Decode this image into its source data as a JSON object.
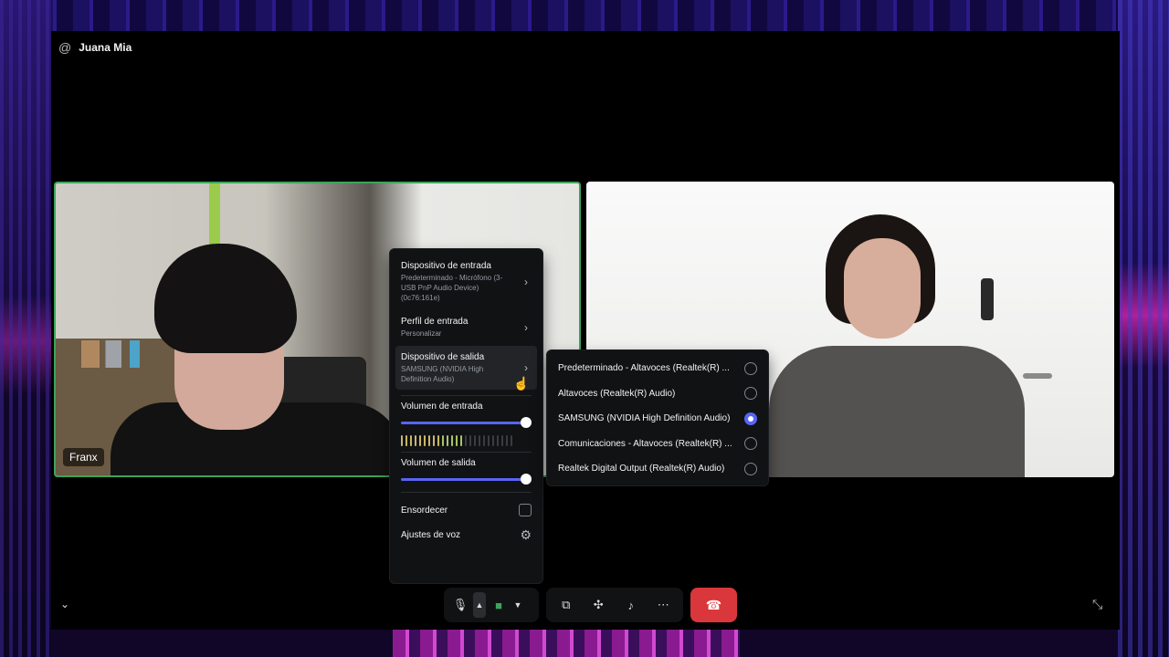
{
  "header": {
    "channel_name": "Juana Mia",
    "at_icon": "at-icon"
  },
  "tiles": {
    "left_name": "Franx"
  },
  "menu": {
    "input_device": {
      "title": "Dispositivo de entrada",
      "sub": "Predeterminado - Micrófono (3- USB PnP Audio Device) (0c76:161e)"
    },
    "input_profile": {
      "title": "Perfil de entrada",
      "sub": "Personalizar"
    },
    "output_device": {
      "title": "Dispositivo de salida",
      "sub": "SAMSUNG (NVIDIA High Definition Audio)"
    },
    "input_volume_label": "Volumen de entrada",
    "input_volume": 1.0,
    "input_meter_level": 0.56,
    "output_volume_label": "Volumen de salida",
    "output_volume": 1.0,
    "deafen_label": "Ensordecer",
    "deafen_checked": false,
    "voice_settings_label": "Ajustes de voz"
  },
  "submenu": {
    "items": [
      {
        "label": "Predeterminado - Altavoces (Realtek(R) ...",
        "selected": false
      },
      {
        "label": "Altavoces (Realtek(R) Audio)",
        "selected": false
      },
      {
        "label": "SAMSUNG (NVIDIA High Definition Audio)",
        "selected": true
      },
      {
        "label": "Comunicaciones - Altavoces (Realtek(R) ...",
        "selected": false
      },
      {
        "label": "Realtek Digital Output (Realtek(R) Audio)",
        "selected": false
      }
    ]
  },
  "colors": {
    "accent": "#5865f2",
    "speaking_border": "#3ba55c",
    "hangup": "#da373c",
    "menu_bg": "#111214"
  },
  "controls": {
    "icons": [
      "microphone-icon",
      "chevron-up-icon",
      "camera-icon",
      "chevron-down-icon",
      "screen-share-icon",
      "activities-icon",
      "soundboard-icon",
      "more-icon",
      "hangup-icon"
    ]
  }
}
